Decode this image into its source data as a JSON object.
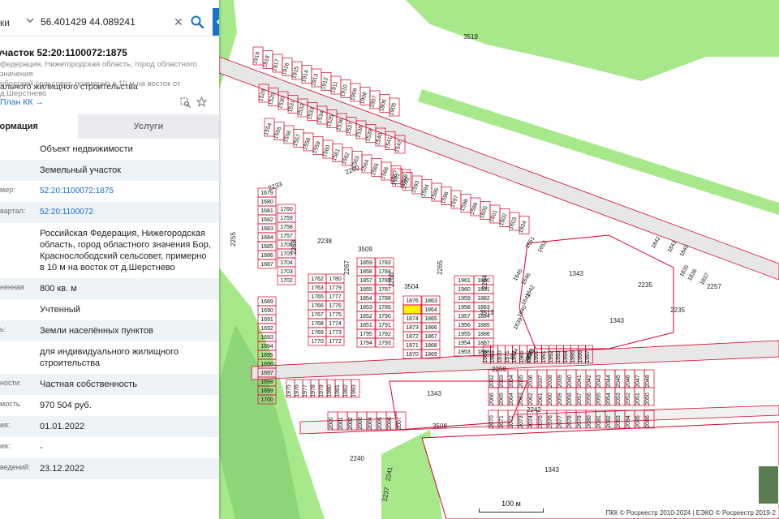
{
  "search": {
    "type_label": "ки",
    "query": "56.401429 44.089241"
  },
  "card": {
    "title": "участок 52:20:1100072:1875",
    "address_line1": "федерация, Нижегородская область, город областного значения",
    "address_line2": "ободский сельсовет, примерно в 10 м на восток от д.Шерстнево",
    "use_line": "ального жилищного строительства",
    "plan_link": "План КК →"
  },
  "tabs": {
    "info": "формация",
    "services": "Услуги"
  },
  "attributes": [
    {
      "key": "",
      "value": "Объект недвижимости",
      "link": false
    },
    {
      "key": "",
      "value": "Земельный участок",
      "link": false
    },
    {
      "key": "мер:",
      "value": "52:20:1100072:1875",
      "link": true
    },
    {
      "key": "вартал:",
      "value": "52:20:1100072",
      "link": true
    },
    {
      "key": "",
      "value": "Российская Федерация, Нижегородская область, город областного значения Бор, Краснослободский сельсовет, примерно в 10 м на восток от д.Шерстнево",
      "link": false
    },
    {
      "key": "ненная",
      "value": "800 кв. м",
      "link": false
    },
    {
      "key": "",
      "value": "Учтенный",
      "link": false
    },
    {
      "key": "ь:",
      "value": "Земли населённых пунктов",
      "link": false
    },
    {
      "key": "",
      "value": "для индивидуального жилищного строительства",
      "link": false
    },
    {
      "key": "ности:",
      "value": "Частная собственность",
      "link": false
    },
    {
      "key": "мость:",
      "value": "970 504 руб.",
      "link": false
    },
    {
      "key": "ия:",
      "value": "01.01.2022",
      "link": false
    },
    {
      "key": "ия:",
      "value": "-",
      "link": false
    },
    {
      "key": "ведений:",
      "value": "23.12.2022",
      "link": false
    }
  ],
  "map": {
    "scale_label": "100 м",
    "attribution": "ПКК © Росреестр 2010-2024 | ЕЭКО © Росреестр 2019-2",
    "colors": {
      "parcel_line": "#d4002a",
      "green": "#a6e88a",
      "selected": "#fff200",
      "road": "#e7e7e7"
    },
    "block_labels": [
      "3519",
      "2238",
      "3509",
      "3504",
      "3512",
      "1343",
      "1343",
      "1343",
      "1343",
      "2235",
      "2235",
      "2257",
      "2259",
      "2260",
      "2233",
      "2255",
      "2268",
      "2267",
      "2266",
      "2265",
      "2264",
      "3508",
      "2240",
      "2241",
      "2237",
      "2242",
      "2239",
      "1875"
    ],
    "row_labels": [
      [
        "1679",
        "1680",
        "1681",
        "1682",
        "1683",
        "1684",
        "1685",
        "1686",
        "1687"
      ],
      [
        "1760",
        "1759",
        "1758",
        "1757",
        "1706",
        "1705",
        "1704",
        "1703",
        "1702"
      ],
      [
        "1762",
        "1763",
        "1765",
        "1766",
        "1767",
        "1768",
        "1769",
        "1770"
      ],
      [
        "1780",
        "1779",
        "1777",
        "1776",
        "1775",
        "1774",
        "1773",
        "1772"
      ],
      [
        "1859",
        "1858",
        "1857",
        "1855",
        "1854",
        "1853",
        "1852",
        "1851",
        "1795",
        "1794"
      ],
      [
        "1783",
        "1784",
        "1785",
        "1787",
        "1788",
        "1789",
        "1790",
        "1791",
        "1792",
        "1793"
      ],
      [
        "1876",
        "1875",
        "1874",
        "1873",
        "1872",
        "1871",
        "1870"
      ],
      [
        "1863",
        "1864",
        "1865",
        "1866",
        "1867",
        "1868",
        "1869"
      ],
      [
        "1961",
        "1960",
        "1959",
        "1958",
        "1957",
        "1956",
        "1955",
        "1954",
        "1953"
      ],
      [
        "1880",
        "1881",
        "1882",
        "1883",
        "1884",
        "1885",
        "1886",
        "1887",
        "1888"
      ],
      [
        "1975",
        "1976",
        "1977",
        "1978",
        "1979",
        "1980",
        "1981",
        "1982",
        "1983"
      ],
      [
        "2000",
        "2001",
        "2002",
        "2003",
        "2004",
        "2005",
        "2006",
        "2007"
      ],
      [
        "2032",
        "2033",
        "2034",
        "2035",
        "2036",
        "2037",
        "2038",
        "2039",
        "2040",
        "2041",
        "2042",
        "2043",
        "2044",
        "2045",
        "2046",
        "2047",
        "2048"
      ],
      [
        "2066",
        "2065",
        "2064",
        "2063",
        "2062",
        "2061",
        "2060",
        "2059",
        "2058",
        "2057",
        "2056",
        "2055",
        "2054",
        "2053",
        "2052",
        "2051",
        "2050"
      ],
      [
        "2070",
        "2071",
        "2072",
        "2073",
        "2074",
        "2075",
        "2076",
        "2077",
        "2078",
        "2079",
        "2080",
        "2081",
        "2082",
        "2083",
        "2084",
        "2085",
        "2086"
      ],
      [
        "1919",
        "1918",
        "1917",
        "1916",
        "1915",
        "1914",
        "1913",
        "1912",
        "1911",
        "1910",
        "1909",
        "1908",
        "1907",
        "1906",
        "1905"
      ],
      [
        "1528",
        "1529",
        "1530",
        "1531",
        "1532",
        "1533",
        "1534",
        "1535",
        "1536",
        "1537",
        "1538",
        "1539",
        "1540",
        "1541",
        "1542"
      ],
      [
        "1554",
        "1555",
        "1556",
        "1557",
        "1558",
        "1559",
        "1560",
        "1561",
        "1562",
        "1563",
        "1564",
        "1565",
        "1566",
        "1567",
        "1568"
      ],
      [
        "1591",
        "1592",
        "1593",
        "1594",
        "1595",
        "1596",
        "1597",
        "1598",
        "1599",
        "1600",
        "1601",
        "1602",
        "1603",
        "1604"
      ],
      [
        "1842",
        "1841",
        "1840",
        "1651",
        "1652",
        "1835",
        "1836",
        "1837",
        "1645",
        "1646",
        "1639",
        "1640",
        "1641",
        "1642",
        "1634",
        "1635"
      ],
      [
        "1968",
        "1969",
        "1970",
        "1971",
        "1972",
        "1966",
        "1967",
        "1990",
        "1991",
        "1992",
        "1993",
        "1994",
        "1995",
        "1996",
        "1997"
      ],
      [
        "1689",
        "1690",
        "1691",
        "1692",
        "1693",
        "1694",
        "1695",
        "1696",
        "1697",
        "1698",
        "1699",
        "1700"
      ]
    ]
  }
}
